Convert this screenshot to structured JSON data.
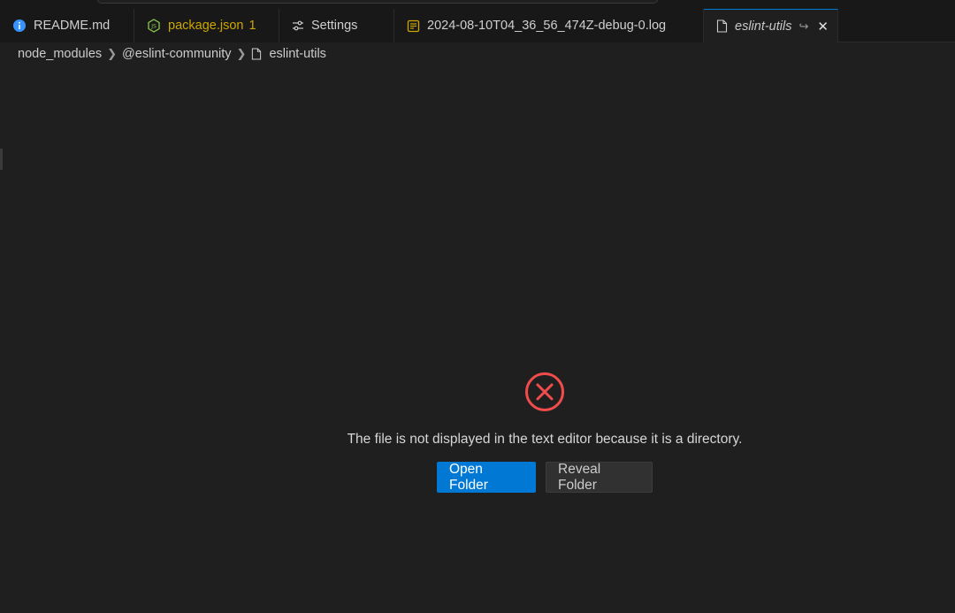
{
  "tabs": [
    {
      "label": "README.md",
      "icon": "info-icon"
    },
    {
      "label": "package.json",
      "badge": "1",
      "icon": "nodejs-icon"
    },
    {
      "label": "Settings",
      "icon": "settings-sliders-icon"
    },
    {
      "label": "2024-08-10T04_36_56_474Z-debug-0.log",
      "icon": "log-file-icon"
    },
    {
      "label": "eslint-utils",
      "icon": "file-icon",
      "active": true
    }
  ],
  "breadcrumb": {
    "items": [
      "node_modules",
      "@eslint-community",
      "eslint-utils"
    ]
  },
  "editor": {
    "message": "The file is not displayed in the text editor because it is a directory.",
    "open_folder_label": "Open Folder",
    "reveal_folder_label": "Reveal Folder"
  },
  "colors": {
    "accent": "#0078d4",
    "error": "#f14c4c",
    "warning": "#cca700",
    "info": "#3794ff"
  }
}
